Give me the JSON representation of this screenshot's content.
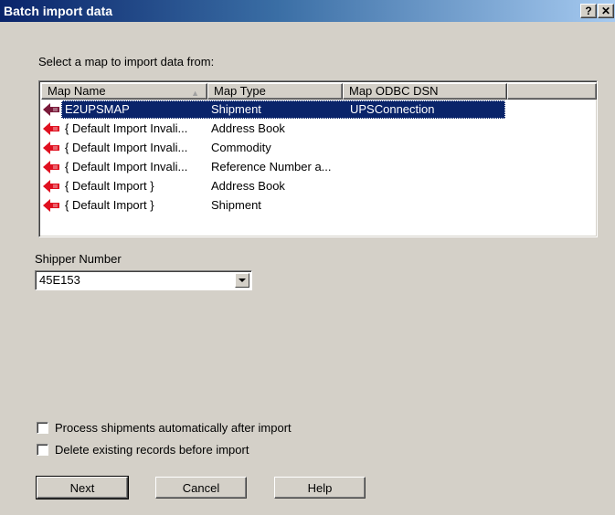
{
  "window": {
    "title": "Batch import data",
    "help_button": "?",
    "close_button": "✕"
  },
  "map_section": {
    "prompt": "Select a map to import data from:",
    "columns": [
      "Map Name",
      "Map Type",
      "Map ODBC DSN"
    ],
    "sorted_column": "Map Name",
    "rows": [
      {
        "name": "E2UPSMAP",
        "type": "Shipment",
        "dsn": "UPSConnection",
        "selected": true,
        "icon": "map-icon"
      },
      {
        "name": "{ Default Import Invali...",
        "type": "Address Book",
        "dsn": "",
        "selected": false,
        "icon": "map-icon"
      },
      {
        "name": "{ Default Import Invali...",
        "type": "Commodity",
        "dsn": "",
        "selected": false,
        "icon": "map-icon"
      },
      {
        "name": "{ Default Import Invali...",
        "type": "Reference Number a...",
        "dsn": "",
        "selected": false,
        "icon": "map-icon"
      },
      {
        "name": "{ Default Import }",
        "type": "Address Book",
        "dsn": "",
        "selected": false,
        "icon": "map-icon"
      },
      {
        "name": "{ Default Import }",
        "type": "Shipment",
        "dsn": "",
        "selected": false,
        "icon": "map-icon"
      }
    ]
  },
  "shipper": {
    "label": "Shipper Number",
    "value": "45E153"
  },
  "options": {
    "process_auto": {
      "label": "Process shipments automatically after import",
      "checked": false
    },
    "delete_existing": {
      "label": "Delete existing records before import",
      "checked": false
    }
  },
  "buttons": {
    "next": "Next",
    "cancel": "Cancel",
    "help": "Help"
  },
  "colors": {
    "titlebar_start": "#0a246a",
    "titlebar_end": "#a6caf0",
    "selection": "#0a246a",
    "face": "#d4d0c8",
    "map_icon": "#e01020"
  }
}
